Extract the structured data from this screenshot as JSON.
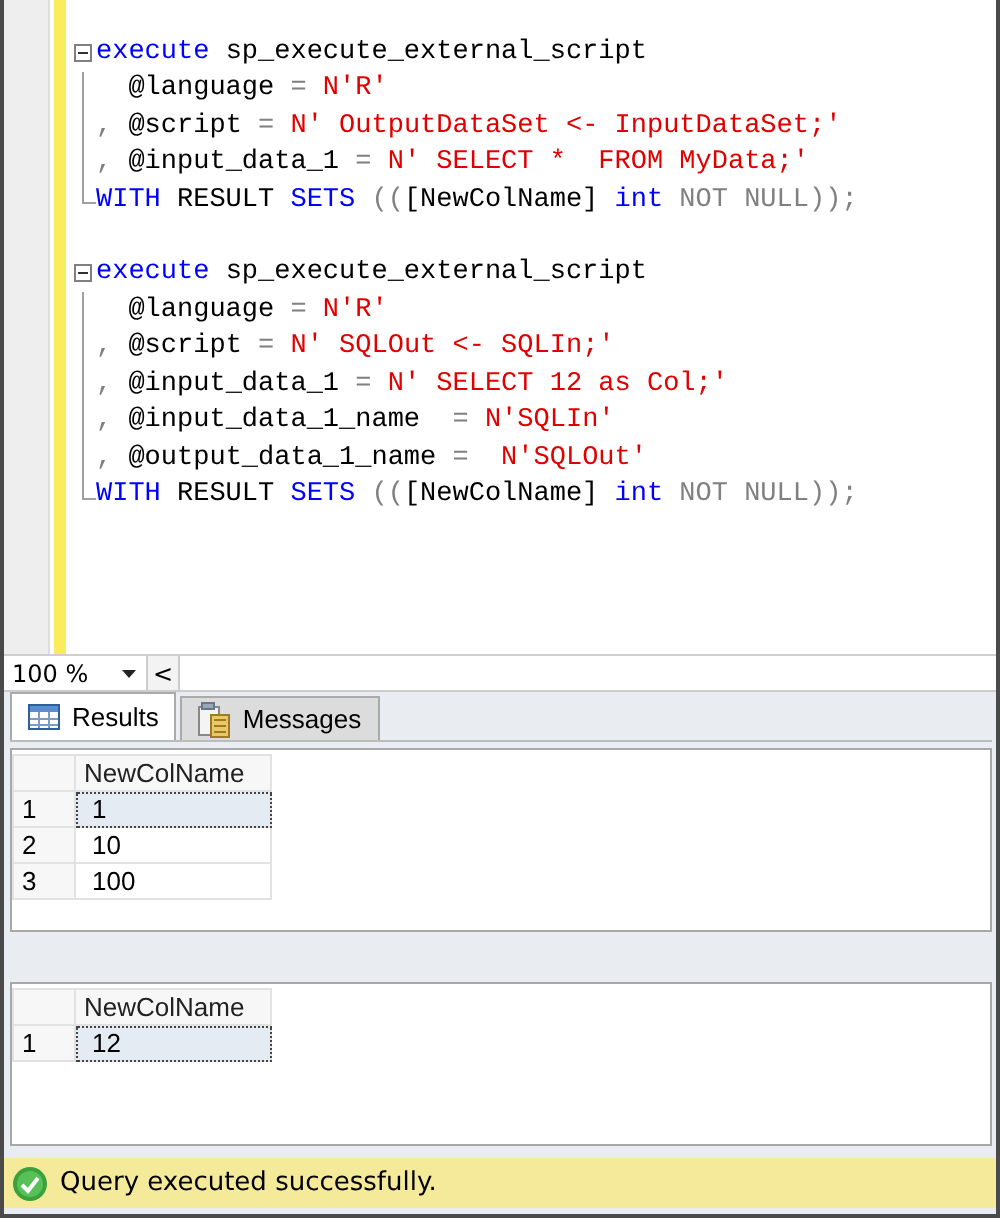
{
  "editor": {
    "blocks": [
      {
        "lines": [
          [
            {
              "kind": "keyword",
              "text": "execute"
            },
            {
              "kind": "plain",
              "text": " sp_execute_external_script"
            }
          ],
          [
            {
              "kind": "plain",
              "text": "  @language "
            },
            {
              "kind": "operator",
              "text": "="
            },
            {
              "kind": "string",
              "text": " N'R'"
            }
          ],
          [
            {
              "kind": "operator",
              "text": ","
            },
            {
              "kind": "plain",
              "text": " @script "
            },
            {
              "kind": "operator",
              "text": "="
            },
            {
              "kind": "string",
              "text": " N' OutputDataSet <- InputDataSet;'"
            }
          ],
          [
            {
              "kind": "operator",
              "text": ","
            },
            {
              "kind": "plain",
              "text": " @input_data_1 "
            },
            {
              "kind": "operator",
              "text": "="
            },
            {
              "kind": "string",
              "text": " N' SELECT *  FROM MyData;'"
            }
          ],
          [
            {
              "kind": "keyword",
              "text": "WITH"
            },
            {
              "kind": "plain",
              "text": " RESULT "
            },
            {
              "kind": "keyword",
              "text": "SETS"
            },
            {
              "kind": "operator",
              "text": " (("
            },
            {
              "kind": "plain",
              "text": "[NewColName] "
            },
            {
              "kind": "keyword",
              "text": "int"
            },
            {
              "kind": "operator",
              "text": " NOT NULL));"
            }
          ]
        ]
      },
      {
        "lines": [
          [
            {
              "kind": "keyword",
              "text": "execute"
            },
            {
              "kind": "plain",
              "text": " sp_execute_external_script"
            }
          ],
          [
            {
              "kind": "plain",
              "text": "  @language "
            },
            {
              "kind": "operator",
              "text": "="
            },
            {
              "kind": "string",
              "text": " N'R'"
            }
          ],
          [
            {
              "kind": "operator",
              "text": ","
            },
            {
              "kind": "plain",
              "text": " @script "
            },
            {
              "kind": "operator",
              "text": "="
            },
            {
              "kind": "string",
              "text": " N' SQLOut <- SQLIn;'"
            }
          ],
          [
            {
              "kind": "operator",
              "text": ","
            },
            {
              "kind": "plain",
              "text": " @input_data_1 "
            },
            {
              "kind": "operator",
              "text": "="
            },
            {
              "kind": "string",
              "text": " N' SELECT 12 as Col;'"
            }
          ],
          [
            {
              "kind": "operator",
              "text": ","
            },
            {
              "kind": "plain",
              "text": " @input_data_1_name  "
            },
            {
              "kind": "operator",
              "text": "="
            },
            {
              "kind": "string",
              "text": " N'SQLIn'"
            }
          ],
          [
            {
              "kind": "operator",
              "text": ","
            },
            {
              "kind": "plain",
              "text": " @output_data_1_name "
            },
            {
              "kind": "operator",
              "text": "="
            },
            {
              "kind": "string",
              "text": "  N'SQLOut'"
            }
          ],
          [
            {
              "kind": "keyword",
              "text": "WITH"
            },
            {
              "kind": "plain",
              "text": " RESULT "
            },
            {
              "kind": "keyword",
              "text": "SETS"
            },
            {
              "kind": "operator",
              "text": " (("
            },
            {
              "kind": "plain",
              "text": "[NewColName] "
            },
            {
              "kind": "keyword",
              "text": "int"
            },
            {
              "kind": "operator",
              "text": " NOT NULL));"
            }
          ]
        ]
      }
    ]
  },
  "zoom": {
    "value": "100 %",
    "scroll_left": "<"
  },
  "tabs": [
    {
      "label": "Results",
      "kind": "grid",
      "selected": true
    },
    {
      "label": "Messages",
      "kind": "messages",
      "selected": false
    }
  ],
  "result_grids": [
    {
      "columns": [
        "NewColName"
      ],
      "rows": [
        {
          "number": "1",
          "cells": [
            "1"
          ],
          "selected": true
        },
        {
          "number": "2",
          "cells": [
            "10"
          ],
          "selected": false
        },
        {
          "number": "3",
          "cells": [
            "100"
          ],
          "selected": false
        }
      ]
    },
    {
      "columns": [
        "NewColName"
      ],
      "rows": [
        {
          "number": "1",
          "cells": [
            "12"
          ],
          "selected": true
        }
      ]
    }
  ],
  "status_bar": {
    "kind": "success",
    "message": "Query executed successfully."
  }
}
